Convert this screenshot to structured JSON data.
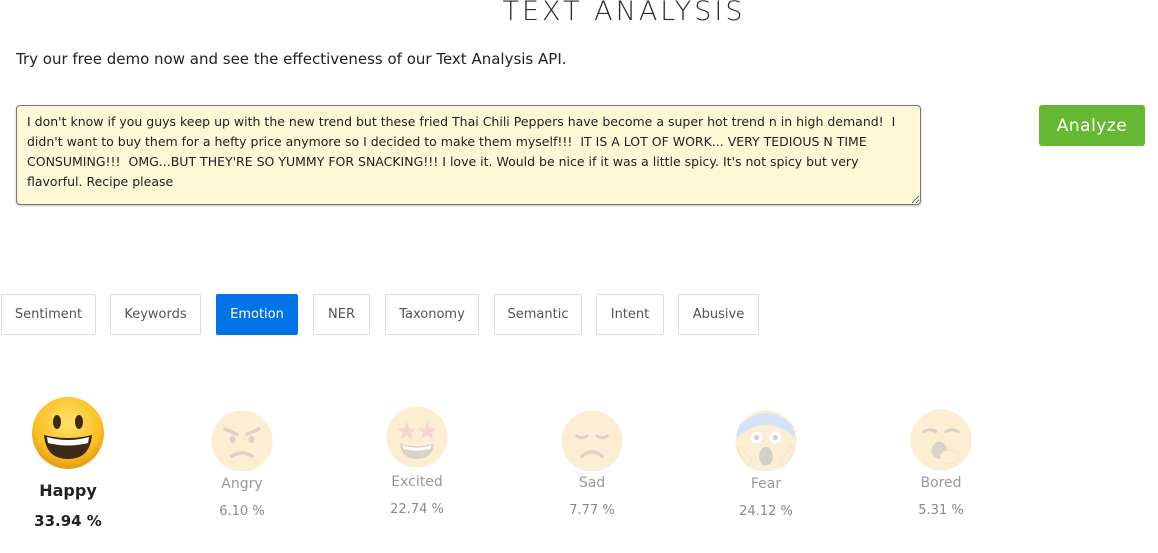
{
  "header": {
    "title": "TEXT ANALYSIS",
    "subtitle": "Try our free demo now and see the effectiveness of our Text Analysis API."
  },
  "input": {
    "value": "I don't know if you guys keep up with the new trend but these fried Thai Chili Peppers have become a super hot trend n in high demand!  I didn't want to buy them for a hefty price anymore so I decided to make them myself!!!  IT IS A LOT OF WORK... VERY TEDIOUS N TIME CONSUMING!!!  OMG...BUT THEY'RE SO YUMMY FOR SNACKING!!! I love it. Would be nice if it was a little spicy. It's not spicy but very flavorful. Recipe please"
  },
  "analyze_button": {
    "label": "Analyze",
    "color": "#66b832"
  },
  "tabs": [
    {
      "label": "Sentiment",
      "active": false
    },
    {
      "label": "Keywords",
      "active": false
    },
    {
      "label": "Emotion",
      "active": true
    },
    {
      "label": "NER",
      "active": false
    },
    {
      "label": "Taxonomy",
      "active": false
    },
    {
      "label": "Semantic",
      "active": false
    },
    {
      "label": "Intent",
      "active": false
    },
    {
      "label": "Abusive",
      "active": false
    }
  ],
  "active_tab_color": "#0073e6",
  "emotions": [
    {
      "label": "Happy",
      "value": "33.94 %",
      "icon": "grinning-face-icon",
      "highlighted": true
    },
    {
      "label": "Angry",
      "value": "6.10 %",
      "icon": "angry-face-icon",
      "highlighted": false
    },
    {
      "label": "Excited",
      "value": "22.74 %",
      "icon": "star-struck-face-icon",
      "highlighted": false
    },
    {
      "label": "Sad",
      "value": "7.77 %",
      "icon": "sad-face-icon",
      "highlighted": false
    },
    {
      "label": "Fear",
      "value": "24.12 %",
      "icon": "screaming-fear-face-icon",
      "highlighted": false
    },
    {
      "label": "Bored",
      "value": "5.31 %",
      "icon": "yawning-face-icon",
      "highlighted": false
    }
  ]
}
